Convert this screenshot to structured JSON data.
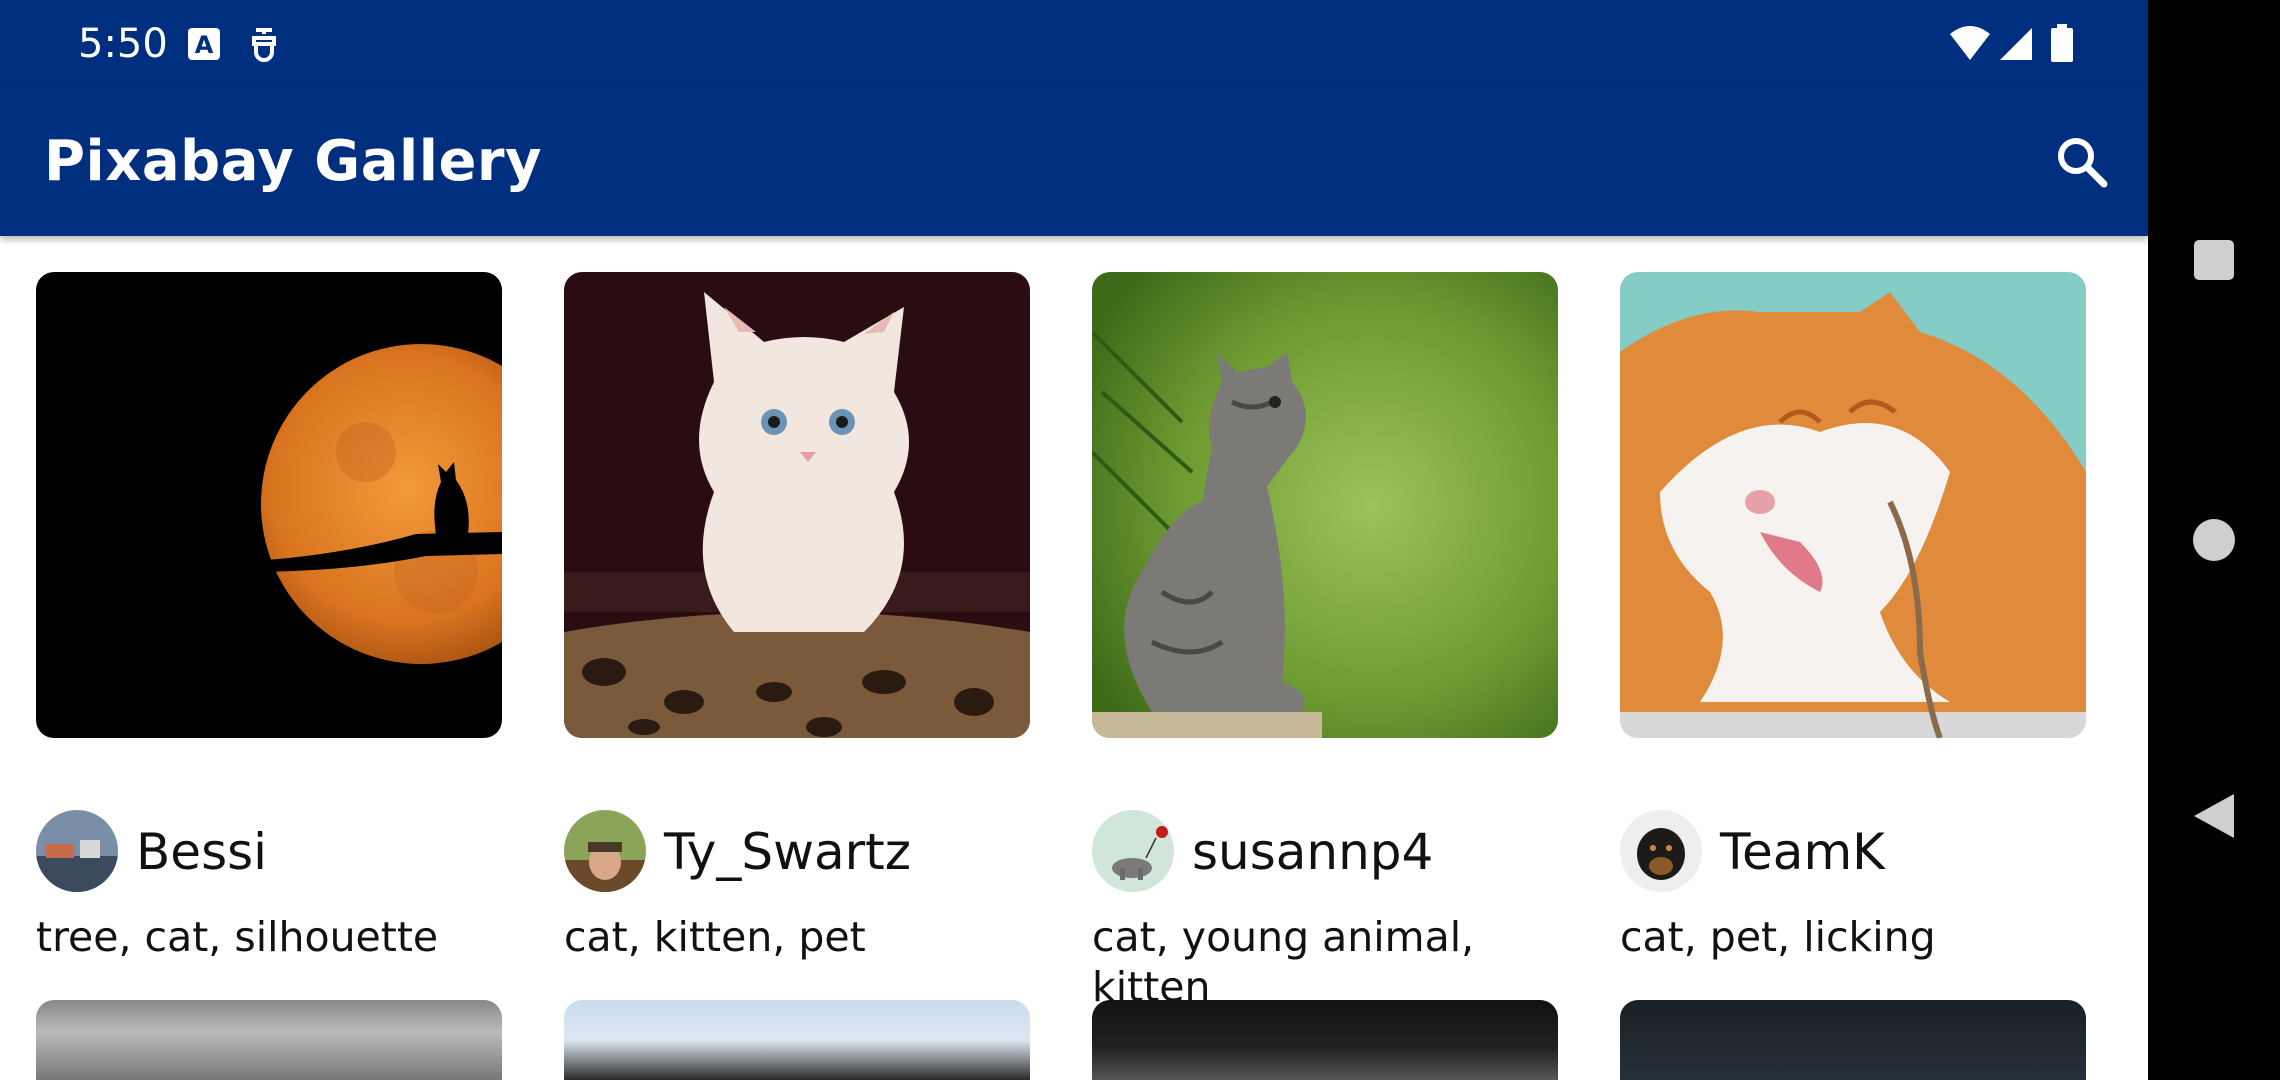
{
  "status_bar": {
    "time": "5:50",
    "icons": [
      "keyboard-a-icon",
      "debug-icon",
      "wifi-icon",
      "cell-signal-icon",
      "battery-icon"
    ]
  },
  "app_bar": {
    "title": "Pixabay Gallery",
    "search_icon": "search-icon"
  },
  "colors": {
    "app_bar": "#002f7f",
    "background": "#ffffff",
    "text": "#111111"
  },
  "gallery": {
    "items": [
      {
        "user": "Bessi",
        "tags": "tree, cat, silhouette",
        "image": "cat silhouette on branch against orange moon"
      },
      {
        "user": "Ty_Swartz",
        "tags": "cat, kitten, pet",
        "image": "white kitten on leopard print cushion"
      },
      {
        "user": "susannp4",
        "tags": "cat, young animal, kitten",
        "image": "grey kitten sitting in green nature"
      },
      {
        "user": "TeamK",
        "tags": "cat, pet, licking",
        "image": "orange and white cat licking"
      }
    ]
  },
  "nav_bar": {
    "buttons": [
      "recents-icon",
      "home-icon",
      "back-icon"
    ]
  }
}
